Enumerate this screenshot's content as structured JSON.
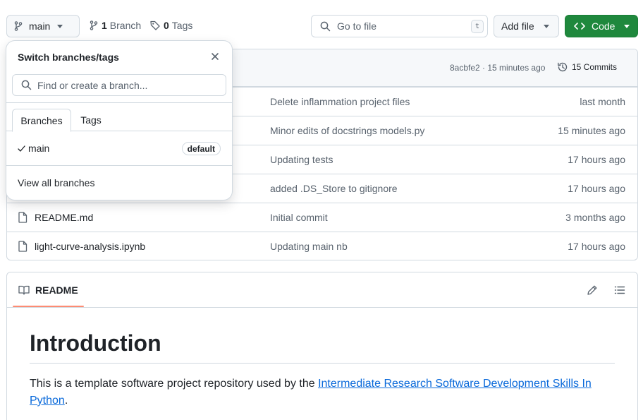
{
  "topbar": {
    "branch": "main",
    "branch_count": "1",
    "branch_label": "Branch",
    "tag_count": "0",
    "tag_label": "Tags",
    "goto_placeholder": "Go to file",
    "goto_shortcut": "t",
    "add_file": "Add file",
    "code": "Code"
  },
  "files": {
    "commit_meta": "8acbfe2 · 15 minutes ago",
    "commits_label": "15 Commits",
    "rows": [
      {
        "name": "",
        "msg": "Delete inflammation project files",
        "age": "last month"
      },
      {
        "name": "",
        "msg": "Minor edits of docstrings models.py",
        "age": "15 minutes ago"
      },
      {
        "name": "",
        "msg": "Updating tests",
        "age": "17 hours ago"
      },
      {
        "name": "",
        "msg": "added .DS_Store to gitignore",
        "age": "17 hours ago"
      },
      {
        "name": "README.md",
        "msg": "Initial commit",
        "age": "3 months ago"
      },
      {
        "name": "light-curve-analysis.ipynb",
        "msg": "Updating main nb",
        "age": "17 hours ago"
      }
    ]
  },
  "readme": {
    "tab": "README",
    "heading": "Introduction",
    "para_prefix": "This is a template software project repository used by the ",
    "link_line1": "Intermediate Research Software Development Skills In",
    "link_line2": "Python",
    "para_suffix": "."
  },
  "dropdown": {
    "title": "Switch branches/tags",
    "search_placeholder": "Find or create a branch...",
    "tab_branches": "Branches",
    "tab_tags": "Tags",
    "branch_name": "main",
    "default_badge": "default",
    "view_all": "View all branches"
  },
  "colors": {
    "accent_green": "#1f883d",
    "link": "#0969da",
    "tab_underline": "#fd8c73"
  }
}
